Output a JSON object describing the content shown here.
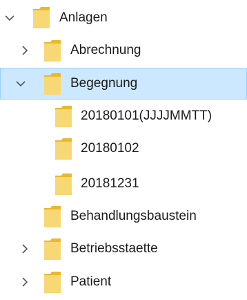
{
  "tree": {
    "items": [
      {
        "label": "Anlagen",
        "expanded": true,
        "selected": false,
        "depth": 0
      },
      {
        "label": "Abrechnung",
        "expanded": false,
        "selected": false,
        "depth": 1
      },
      {
        "label": "Begegnung",
        "expanded": true,
        "selected": true,
        "depth": 1
      },
      {
        "label": "20180101(JJJJMMTT)",
        "expanded": null,
        "selected": false,
        "depth": 2
      },
      {
        "label": "20180102",
        "expanded": null,
        "selected": false,
        "depth": 2
      },
      {
        "label": "20181231",
        "expanded": null,
        "selected": false,
        "depth": 2
      },
      {
        "label": "Behandlungsbaustein",
        "expanded": null,
        "selected": false,
        "depth": 1
      },
      {
        "label": "Betriebsstaette",
        "expanded": false,
        "selected": false,
        "depth": 1
      },
      {
        "label": "Patient",
        "expanded": false,
        "selected": false,
        "depth": 1
      }
    ]
  },
  "colors": {
    "selection_background": "#cce8ff",
    "selection_border": "#99d1ff",
    "folder_fill": "#f8d775",
    "folder_shade": "#e8b830",
    "chevron": "#555555"
  },
  "icons": {
    "expanded": "chevron-down-icon",
    "collapsed": "chevron-right-icon",
    "folder": "folder-icon"
  }
}
